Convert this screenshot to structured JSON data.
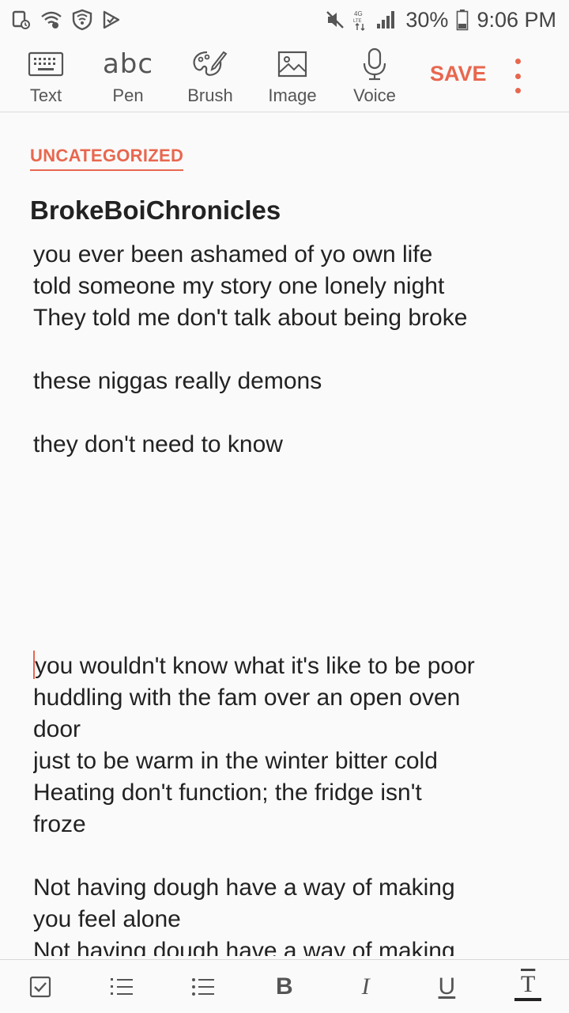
{
  "status_bar": {
    "battery_percent": "30%",
    "time": "9:06 PM",
    "network_type": "4G LTE",
    "icons": [
      "screenshot-icon",
      "wifi-call-icon",
      "vpn-shield-icon",
      "check-flag-icon",
      "mute-icon",
      "data-arrows-icon",
      "signal-icon",
      "battery-icon"
    ]
  },
  "toolbar": {
    "tools": [
      {
        "label": "Text",
        "icon": "keyboard-icon"
      },
      {
        "label": "Pen",
        "icon": "pen-abc-icon",
        "glyph": "abc"
      },
      {
        "label": "Brush",
        "icon": "palette-brush-icon"
      },
      {
        "label": "Image",
        "icon": "image-icon"
      },
      {
        "label": "Voice",
        "icon": "microphone-icon"
      }
    ],
    "save_label": "SAVE",
    "more_icon": "more-vertical-icon"
  },
  "note": {
    "category": "UNCATEGORIZED",
    "title": "BrokeBoiChronicles",
    "lines": [
      "you ever been ashamed of yo own life",
      "told someone my story one lonely night",
      "They told me don't talk about being broke",
      "",
      "these niggas really demons",
      "",
      "they don't need to know",
      "",
      "",
      "",
      "",
      "",
      "",
      "you wouldn't know what it's like to be poor",
      "huddling with the fam over an open oven",
      "door",
      "just to be warm in the winter bitter cold",
      "Heating don't function; the fridge isn't",
      "froze",
      "",
      "Not having dough have a way of making",
      "you feel alone",
      "Not having dough have a way of making"
    ]
  },
  "format_bar": {
    "items": [
      {
        "name": "checkbox-icon"
      },
      {
        "name": "numbered-list-icon"
      },
      {
        "name": "bulleted-list-icon"
      },
      {
        "name": "bold-button",
        "glyph": "B"
      },
      {
        "name": "italic-button",
        "glyph": "I"
      },
      {
        "name": "underline-button",
        "glyph": "U"
      },
      {
        "name": "text-style-button",
        "glyph": "T"
      }
    ]
  },
  "colors": {
    "accent": "#e8674f",
    "background": "#fafafa",
    "text": "#222222",
    "icon": "#555555"
  }
}
